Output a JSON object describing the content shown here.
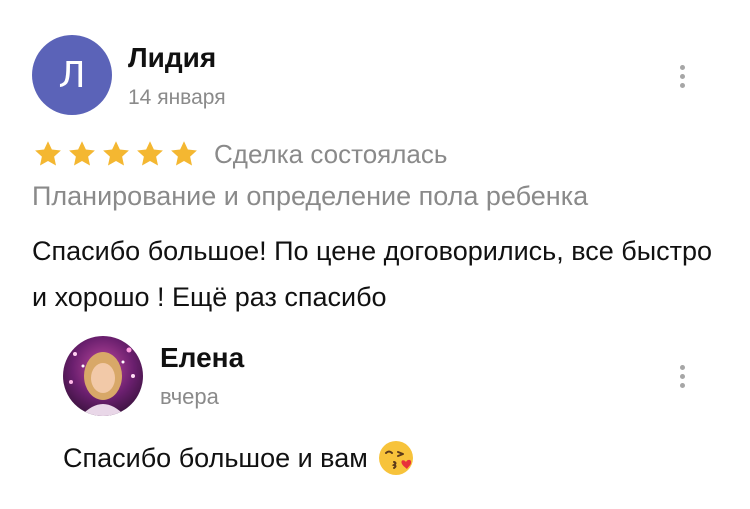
{
  "review": {
    "author": {
      "initial": "Л",
      "name": "Лидия",
      "date": "14 января",
      "avatar_color": "#5b63b8"
    },
    "rating": 5,
    "max_rating": 5,
    "star_color": "#f4b731",
    "status": "Сделка состоялась",
    "category": "Планирование и определение пола ребенка",
    "text": "Спасибо большое! По цене договорились, все быстро и хорошо ! Ещё раз спасибо",
    "menu_icon": "more-vertical-icon"
  },
  "reply": {
    "author": {
      "name": "Елена",
      "date": "вчера"
    },
    "text": "Спасибо большое и вам",
    "emoji_icon": "face-blowing-kiss-icon",
    "menu_icon": "more-vertical-icon"
  }
}
